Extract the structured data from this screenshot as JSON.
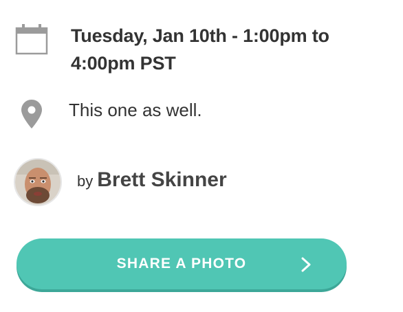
{
  "event": {
    "date_time": "Tuesday, Jan 10th - 1:00pm to 4:00pm PST",
    "location": "This one as well.",
    "calendar_icon": "calendar-icon",
    "location_icon": "map-pin-icon"
  },
  "author": {
    "by_label": "by",
    "name": "Brett Skinner",
    "avatar_icon": "avatar"
  },
  "actions": {
    "share_label": "SHARE A PHOTO",
    "share_icon": "chevron-right-icon"
  },
  "colors": {
    "accent": "#50c6b4",
    "accent_shadow": "#3da798",
    "icon_gray": "#9b9b9b",
    "text": "#333333"
  }
}
